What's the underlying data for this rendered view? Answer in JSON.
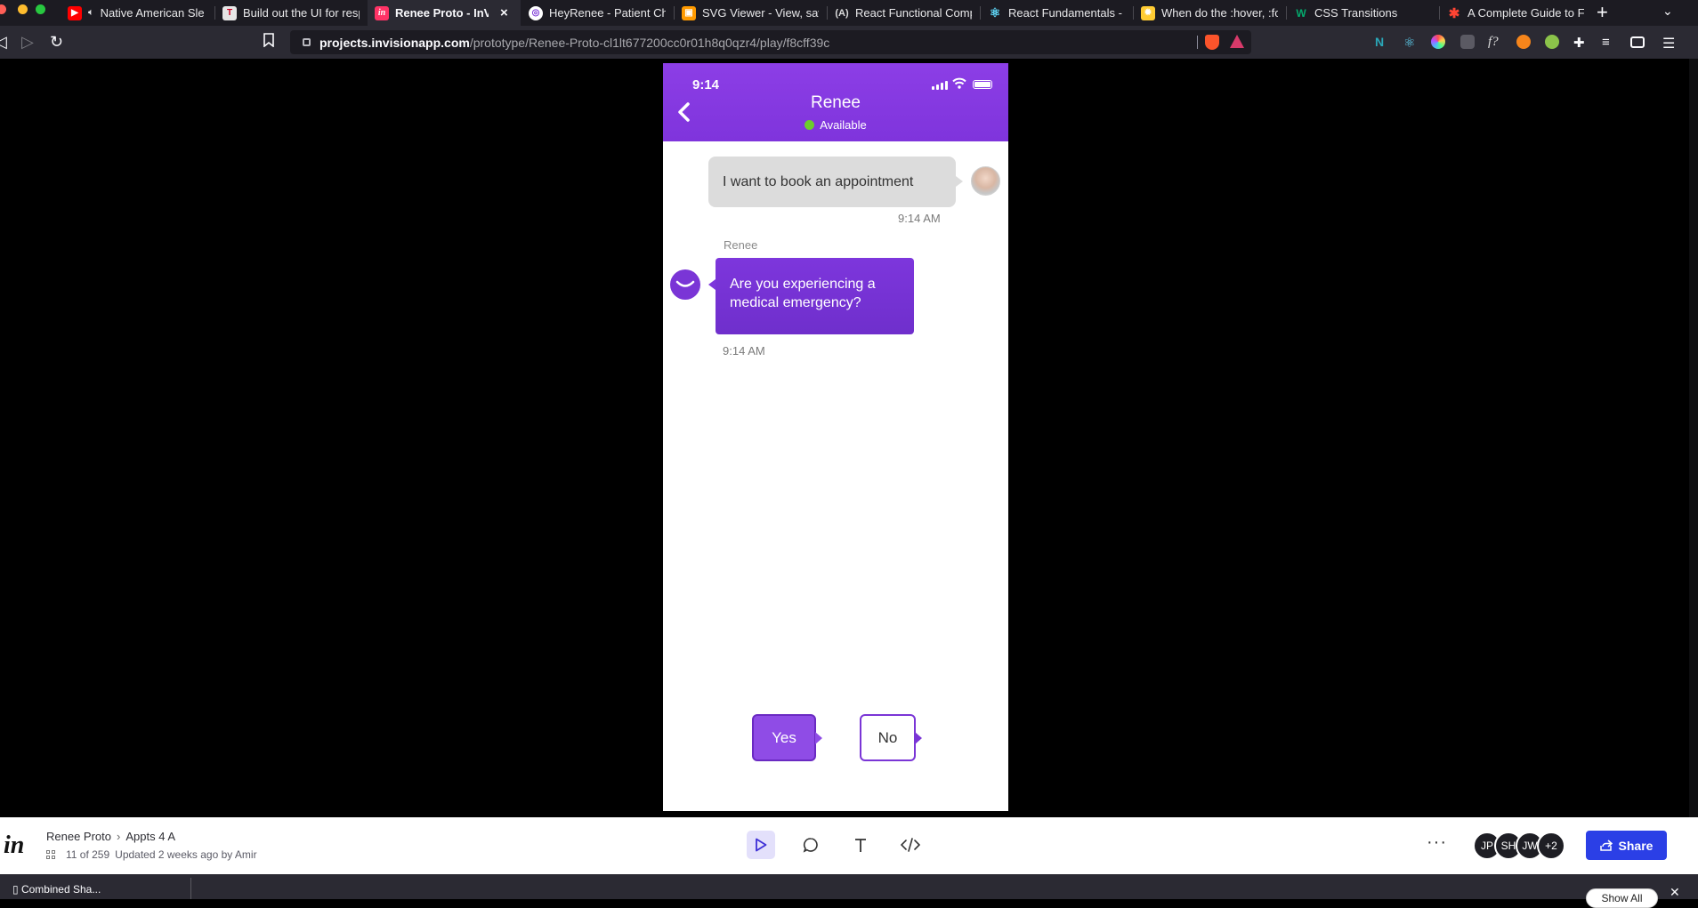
{
  "browser": {
    "tabs": [
      {
        "title": "Native American Sle",
        "icon": "youtube-icon",
        "color": "#ff0000",
        "audio": true
      },
      {
        "title": "Build out the UI for resp",
        "icon": "trello-icon",
        "color": "#e6e6e6"
      },
      {
        "title": "Renee Proto - InVisi",
        "icon": "invision-icon",
        "color": "#ff3366",
        "active": true
      },
      {
        "title": "HeyRenee - Patient Cha",
        "icon": "figma-icon",
        "color": "#ffffff"
      },
      {
        "title": "SVG Viewer - View, sav",
        "icon": "svgviewer-icon",
        "color": "#ff9a00"
      },
      {
        "title": "React Functional Comp",
        "icon": "a-icon",
        "color": "#2b2a33"
      },
      {
        "title": "React Fundamentals - R",
        "icon": "react-icon",
        "color": "#61dafb"
      },
      {
        "title": "When do the :hover, :fo",
        "icon": "star-icon",
        "color": "#ffcc33"
      },
      {
        "title": "CSS Transitions",
        "icon": "w3-icon",
        "color": "#04aa6d"
      },
      {
        "title": "A Complete Guide to Fle",
        "icon": "csstricks-icon",
        "color": "#ff4433"
      }
    ],
    "tab_close_glyph": "×",
    "new_tab_glyph": "+",
    "url_host": "projects.invisionapp.com",
    "url_path": "/prototype/Renee-Proto-cl1lt677200cc0r01h8q0qzr4/play/f8cff39c"
  },
  "phone": {
    "status_time": "9:14",
    "contact_name": "Renee",
    "presence": "Available",
    "colors": {
      "header": "#8039de",
      "presence": "#6ccd2c",
      "bubble_bot": "#7332d2"
    },
    "messages": [
      {
        "from": "user",
        "text": "I want to book an appointment",
        "time": "9:14 AM"
      },
      {
        "from": "bot",
        "sender": "Renee",
        "text": "Are you experiencing a medical emergency?",
        "time": "9:14 AM"
      }
    ],
    "quick_replies": [
      "Yes",
      "No"
    ]
  },
  "footer": {
    "logo": "in",
    "project": "Renee Proto",
    "screen": "Appts 4 A",
    "position": "11 of 259",
    "updated": "Updated 2 weeks ago by Amir",
    "collaborators": [
      "JP",
      "SH",
      "JW",
      "+2"
    ],
    "more_glyph": "···",
    "share_label": "Share",
    "accent": "#2b3fe6"
  },
  "download_bar": {
    "file_name": "Combined Sha...",
    "show_all": "Show All"
  }
}
